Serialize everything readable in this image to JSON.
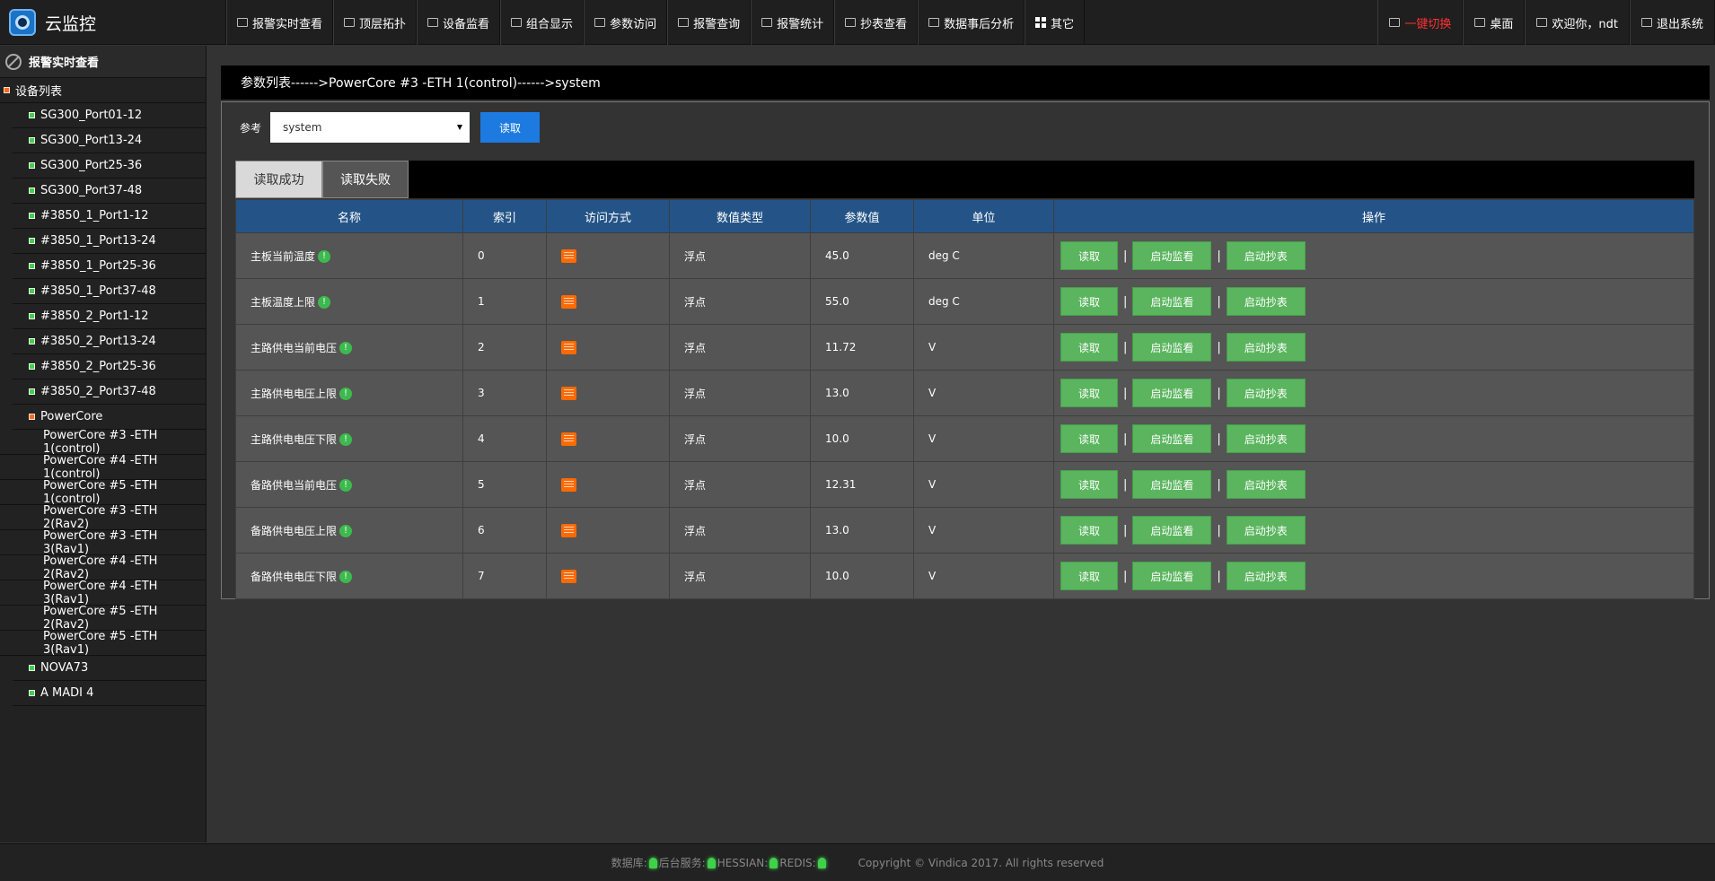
{
  "app": {
    "title": "云监控"
  },
  "nav": {
    "items": [
      "报警实时查看",
      "顶层拓扑",
      "设备监看",
      "组合显示",
      "参数访问",
      "报警查询",
      "报警统计",
      "抄表查看",
      "数据事后分析",
      "其它"
    ],
    "right": {
      "switch": "一键切换",
      "desktop": "桌面",
      "welcome": "欢迎你，ndt",
      "logout": "退出系统"
    }
  },
  "sidebar": {
    "header": "报警实时查看",
    "root": "设备列表",
    "devices": [
      "SG300_Port01-12",
      "SG300_Port13-24",
      "SG300_Port25-36",
      "SG300_Port37-48",
      "#3850_1_Port1-12",
      "#3850_1_Port13-24",
      "#3850_1_Port25-36",
      "#3850_1_Port37-48",
      "#3850_2_Port1-12",
      "#3850_2_Port13-24",
      "#3850_2_Port25-36",
      "#3850_2_Port37-48"
    ],
    "powercore": {
      "label": "PowerCore",
      "children": [
        "PowerCore #3 -ETH 1(control)",
        "PowerCore #4 -ETH 1(control)",
        "PowerCore #5 -ETH 1(control)",
        "PowerCore #3 -ETH 2(Rav2)",
        "PowerCore #3 -ETH 3(Rav1)",
        "PowerCore #4 -ETH 2(Rav2)",
        "PowerCore #4 -ETH 3(Rav1)",
        "PowerCore #5 -ETH 2(Rav2)",
        "PowerCore #5 -ETH 3(Rav1)"
      ]
    },
    "tail": [
      "NOVA73",
      "A MADI 4"
    ]
  },
  "main": {
    "breadcrumb": "参数列表------>PowerCore #3 -ETH 1(control)------>system",
    "ref_label": "参考",
    "select_value": "system",
    "read_button": "读取",
    "tabs": [
      "读取成功",
      "读取失败"
    ],
    "columns": [
      "名称",
      "索引",
      "访问方式",
      "数值类型",
      "参数值",
      "单位",
      "操作"
    ],
    "rows": [
      {
        "name": "主板当前温度",
        "index": "0",
        "type": "浮点",
        "value": "45.0",
        "unit": "deg C"
      },
      {
        "name": "主板温度上限",
        "index": "1",
        "type": "浮点",
        "value": "55.0",
        "unit": "deg C"
      },
      {
        "name": "主路供电当前电压",
        "index": "2",
        "type": "浮点",
        "value": "11.72",
        "unit": "V"
      },
      {
        "name": "主路供电电压上限",
        "index": "3",
        "type": "浮点",
        "value": "13.0",
        "unit": "V"
      },
      {
        "name": "主路供电电压下限",
        "index": "4",
        "type": "浮点",
        "value": "10.0",
        "unit": "V"
      },
      {
        "name": "备路供电当前电压",
        "index": "5",
        "type": "浮点",
        "value": "12.31",
        "unit": "V"
      },
      {
        "name": "备路供电电压上限",
        "index": "6",
        "type": "浮点",
        "value": "13.0",
        "unit": "V"
      },
      {
        "name": "备路供电电压下限",
        "index": "7",
        "type": "浮点",
        "value": "10.0",
        "unit": "V"
      }
    ],
    "ops": {
      "read": "读取",
      "monitor": "启动监看",
      "meter": "启动抄表",
      "sep": "|"
    }
  },
  "footer": {
    "db": "数据库:",
    "backend": "后台服务:",
    "hessian": "HESSIAN:",
    "redis": "REDIS:",
    "copyright": "Copyright © Vindica 2017. All rights reserved"
  },
  "colors": {
    "accent": "#1c7ae0",
    "header_blue": "#245487",
    "ok_green": "#5ab55e",
    "alert_red": "#ff3030"
  }
}
